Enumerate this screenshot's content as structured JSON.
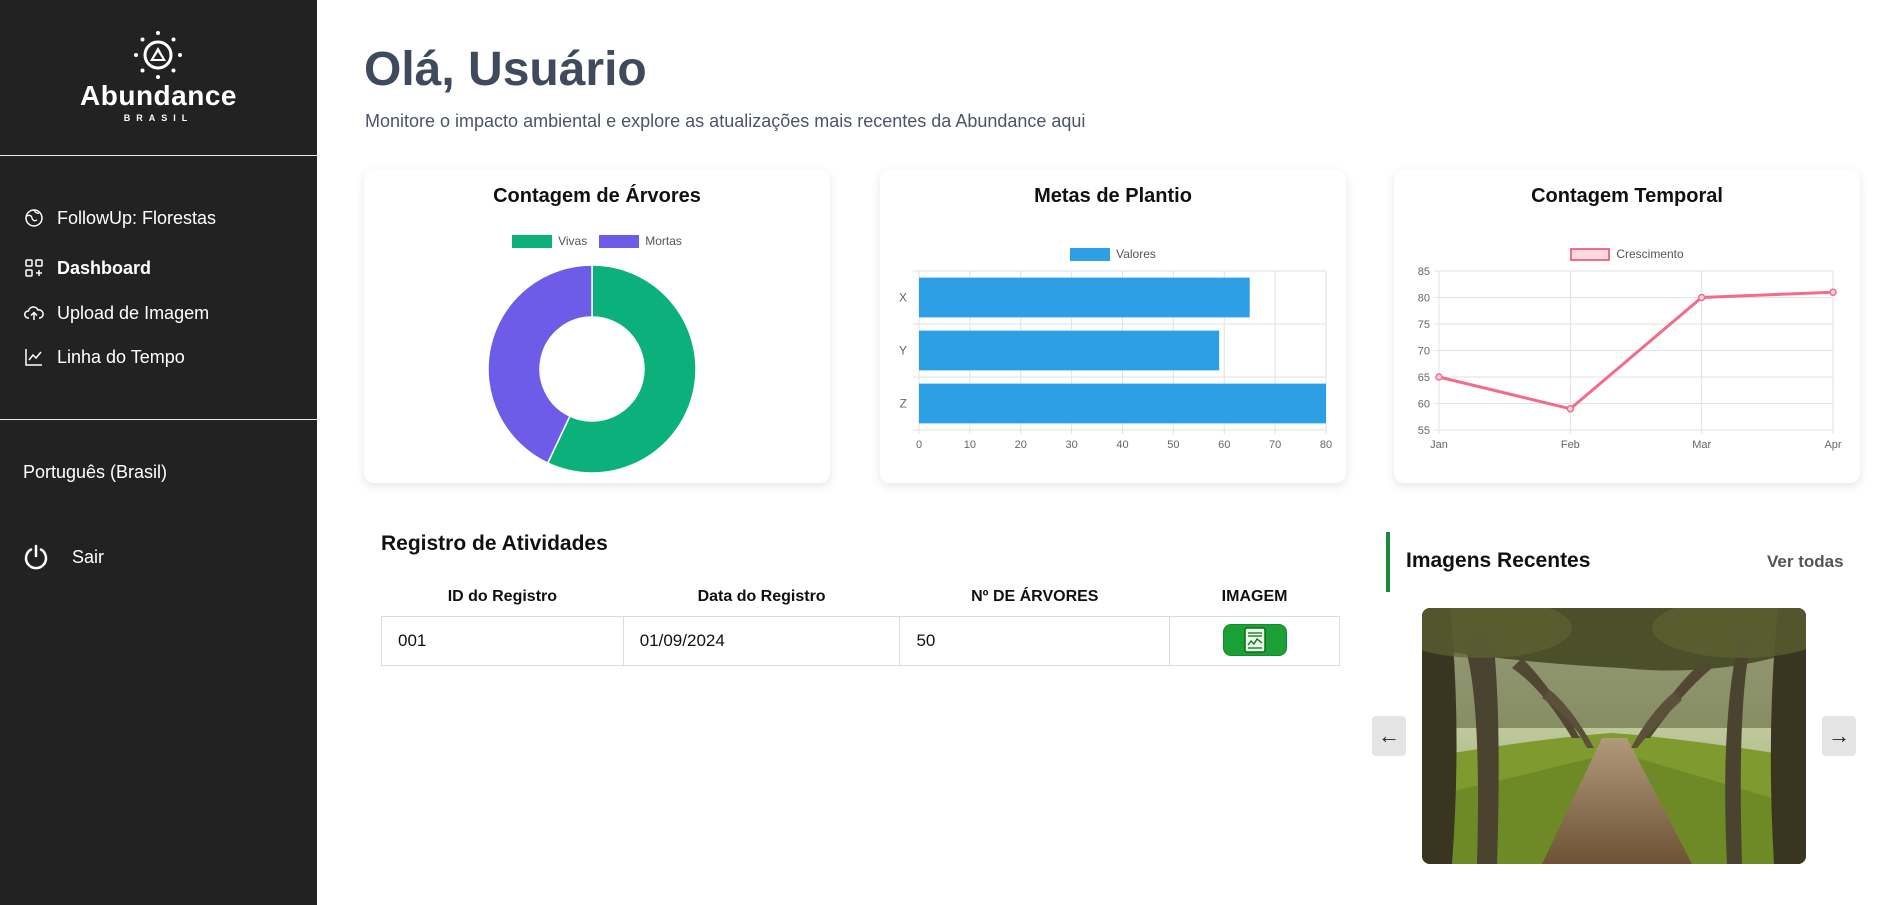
{
  "brand": {
    "name": "Abundance",
    "sub": "BRASIL"
  },
  "sidebar": {
    "items": [
      {
        "label": "FollowUp: Florestas",
        "icon": "globe-icon"
      },
      {
        "label": "Dashboard",
        "icon": "dashboard-icon",
        "active": true
      },
      {
        "label": "Upload de Imagem",
        "icon": "cloud-upload-icon"
      },
      {
        "label": "Linha do Tempo",
        "icon": "line-chart-icon"
      }
    ],
    "language": "Português (Brasil)",
    "logout": "Sair"
  },
  "header": {
    "greeting": "Olá, Usuário",
    "subtitle": "Monitore o impacto ambiental e explore as atualizações mais recentes da Abundance aqui"
  },
  "chart_data": [
    {
      "type": "pie",
      "title": "Contagem de Árvores",
      "donut": true,
      "categories": [
        "Vivas",
        "Mortas"
      ],
      "values": [
        57,
        43
      ],
      "colors": [
        "#0bb07b",
        "#6c5ce7"
      ],
      "legend": "top"
    },
    {
      "type": "bar",
      "orientation": "horizontal",
      "title": "Metas de Plantio",
      "categories": [
        "X",
        "Y",
        "Z"
      ],
      "series": [
        {
          "name": "Valores",
          "values": [
            65,
            59,
            80
          ],
          "color": "#2c9fe5"
        }
      ],
      "xlim": [
        0,
        80
      ],
      "xticks": [
        0,
        10,
        20,
        30,
        40,
        50,
        60,
        70,
        80
      ],
      "grid": true,
      "legend": "top"
    },
    {
      "type": "line",
      "title": "Contagem Temporal",
      "categories": [
        "Jan",
        "Feb",
        "Mar",
        "Apr"
      ],
      "series": [
        {
          "name": "Crescimento",
          "values": [
            65,
            59,
            80,
            81
          ],
          "color": "#f26b8a"
        }
      ],
      "ylim": [
        55,
        85
      ],
      "yticks": [
        55,
        60,
        65,
        70,
        75,
        80,
        85
      ],
      "grid": true,
      "legend": "top"
    }
  ],
  "activity": {
    "title": "Registro de Atividades",
    "columns": [
      "ID do Registro",
      "Data do Registro",
      "Nº DE ÁRVORES",
      "IMAGEM"
    ],
    "rows": [
      {
        "id": "001",
        "date": "01/09/2024",
        "trees": "50"
      }
    ]
  },
  "recent": {
    "title": "Imagens Recentes",
    "see_all": "Ver todas",
    "prev": "←",
    "next": "→"
  }
}
